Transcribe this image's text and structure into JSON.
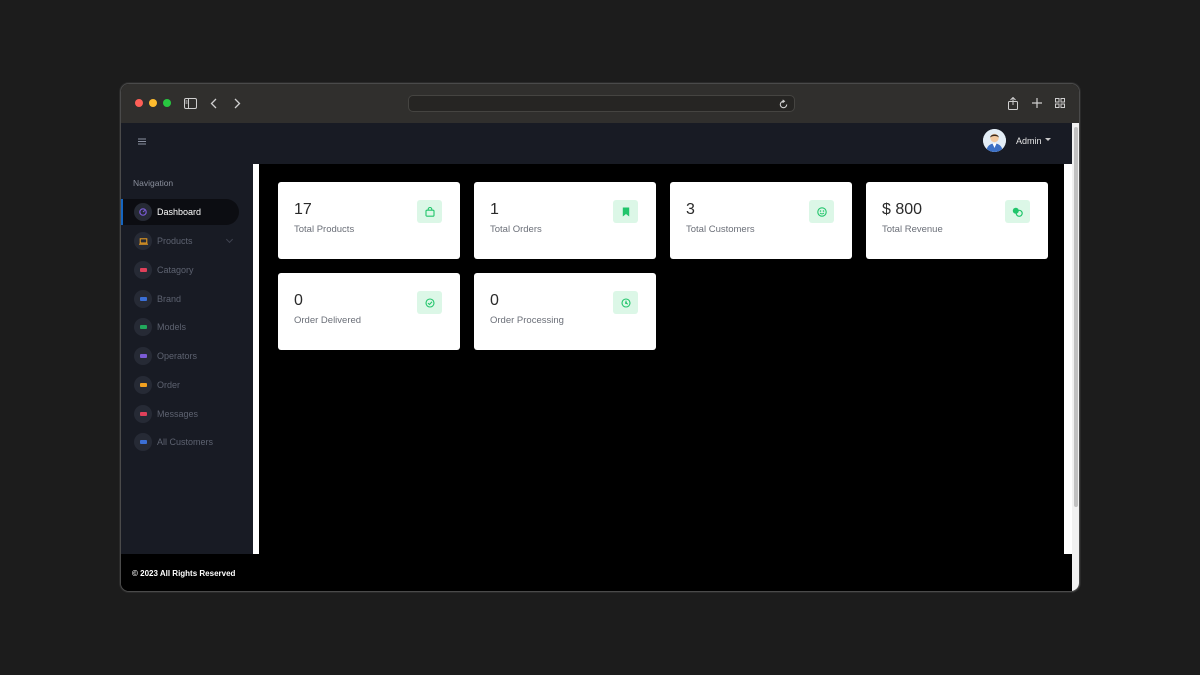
{
  "browser": {
    "url": "",
    "icons": [
      "sidebar-toggle-icon",
      "back-icon",
      "forward-icon",
      "reload-icon",
      "share-icon",
      "new-tab-icon",
      "tab-overview-icon"
    ]
  },
  "header": {
    "user_name": "Admin"
  },
  "sidebar": {
    "heading": "Navigation",
    "items": [
      {
        "label": "Dashboard",
        "icon": "dashboard-icon",
        "color": "#7b5cd6",
        "active": true
      },
      {
        "label": "Products",
        "icon": "laptop-icon",
        "color": "#f0a020",
        "has_submenu": true
      },
      {
        "label": "Catagory",
        "icon": "category-icon",
        "color": "#e0405a"
      },
      {
        "label": "Brand",
        "icon": "brand-icon",
        "color": "#3b6fd6"
      },
      {
        "label": "Models",
        "icon": "models-icon",
        "color": "#21a85c"
      },
      {
        "label": "Operators",
        "icon": "operators-icon",
        "color": "#7b5cd6"
      },
      {
        "label": "Order",
        "icon": "order-icon",
        "color": "#f0a020"
      },
      {
        "label": "Messages",
        "icon": "messages-icon",
        "color": "#e0405a"
      },
      {
        "label": "All Customers",
        "icon": "customers-icon",
        "color": "#3b6fd6"
      }
    ]
  },
  "stats": [
    {
      "value": "17",
      "label": "Total Products",
      "icon": "bag-icon"
    },
    {
      "value": "1",
      "label": "Total Orders",
      "icon": "bookmark-icon"
    },
    {
      "value": "3",
      "label": "Total Customers",
      "icon": "smile-icon"
    },
    {
      "value": "$ 800",
      "label": "Total Revenue",
      "icon": "coins-icon"
    },
    {
      "value": "0",
      "label": "Order Delivered",
      "icon": "check-circle-icon"
    },
    {
      "value": "0",
      "label": "Order Processing",
      "icon": "processing-icon"
    }
  ],
  "footer": {
    "text": "© 2023 All Rights Reserved"
  },
  "colors": {
    "accent": "#21c56b",
    "badge_bg": "#dcf7e7",
    "sidebar_bg": "#181b24",
    "active_indicator": "#1565c0"
  }
}
